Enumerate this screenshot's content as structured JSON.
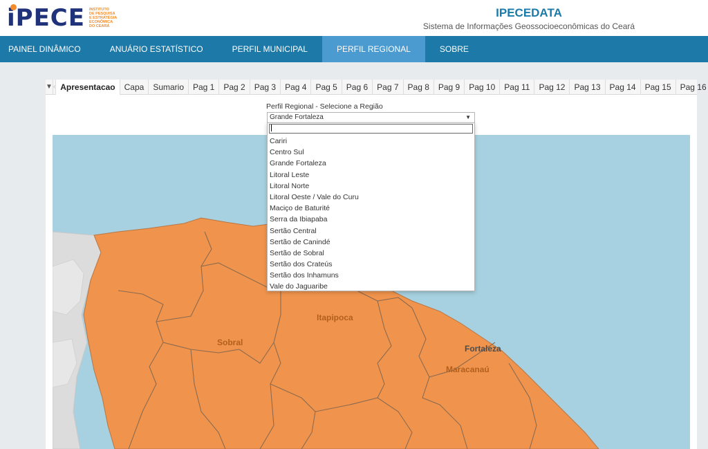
{
  "logo": {
    "text": "iPECE",
    "tagline": [
      "INSTITUTO",
      "DE PESQUISA",
      "E ESTRATÉGIA",
      "ECONÔMICA",
      "DO CEARÁ"
    ]
  },
  "header": {
    "title": "IPECEDATA",
    "subtitle": "Sistema de Informações Geossocioeconômicas do Ceará"
  },
  "nav": {
    "items": [
      {
        "label": "PAINEL DINÂMICO",
        "active": false
      },
      {
        "label": "ANUÁRIO ESTATÍSTICO",
        "active": false
      },
      {
        "label": "PERFIL MUNICIPAL",
        "active": false
      },
      {
        "label": "PERFIL REGIONAL",
        "active": true
      },
      {
        "label": "SOBRE",
        "active": false
      }
    ]
  },
  "tabs": {
    "items": [
      "Apresentacao",
      "Capa",
      "Sumario",
      "Pag 1",
      "Pag 2",
      "Pag 3",
      "Pag 4",
      "Pag 5",
      "Pag 6",
      "Pag 7",
      "Pag 8",
      "Pag 9",
      "Pag 10",
      "Pag 11",
      "Pag 12",
      "Pag 13",
      "Pag 14",
      "Pag 15",
      "Pag 16"
    ],
    "active_index": 0
  },
  "filter": {
    "label": "Perfil Regional - Selecione a Região",
    "selected": "Grande Fortaleza",
    "search_value": "",
    "options": [
      "Cariri",
      "Centro Sul",
      "Grande Fortaleza",
      "Litoral Leste",
      "Litoral Norte",
      "Litoral Oeste / Vale do Curu",
      "Maciço de Baturité",
      "Serra da Ibiapaba",
      "Sertão Central",
      "Sertão de Canindé",
      "Sertão de Sobral",
      "Sertão dos Crateús",
      "Sertão dos Inhamuns",
      "Vale do Jaguaribe"
    ]
  },
  "map": {
    "labels": {
      "sobral": "Sobral",
      "itapipoca": "Itapipoca",
      "fortaleza": "Fortaleza",
      "maracanau": "Maracanaú"
    },
    "colors": {
      "sea": "#a7d1e0",
      "land_other": "#dcdcdc",
      "region": "#f0944d",
      "border": "#8c6a4f"
    }
  }
}
